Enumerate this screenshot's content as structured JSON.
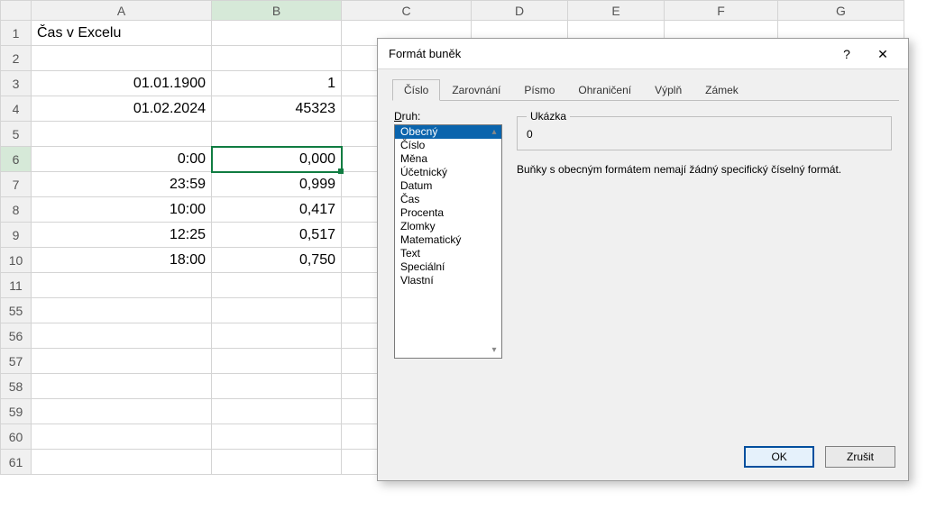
{
  "sheet": {
    "columns": [
      "A",
      "B",
      "C",
      "D",
      "E",
      "F",
      "G"
    ],
    "rows": [
      "1",
      "2",
      "3",
      "4",
      "5",
      "6",
      "7",
      "8",
      "9",
      "10",
      "11",
      "55",
      "56",
      "57",
      "58",
      "59",
      "60",
      "61"
    ],
    "active_col": "B",
    "active_row": "6",
    "title": "Čas v Excelu",
    "cells": {
      "A3": "01.01.1900",
      "B3": "1",
      "A4": "01.02.2024",
      "B4": "45323",
      "A6": "0:00",
      "B6": "0,000",
      "A7": "23:59",
      "B7": "0,999",
      "A8": "10:00",
      "B8": "0,417",
      "A9": "12:25",
      "B9": "0,517",
      "A10": "18:00",
      "B10": "0,750"
    }
  },
  "dialog": {
    "title": "Formát buněk",
    "help_icon": "?",
    "close_icon": "✕",
    "tabs": [
      "Číslo",
      "Zarovnání",
      "Písmo",
      "Ohraničení",
      "Výplň",
      "Zámek"
    ],
    "active_tab": 0,
    "druh_label_pre": "D",
    "druh_label_post": "ruh:",
    "categories": [
      "Obecný",
      "Číslo",
      "Měna",
      "Účetnický",
      "Datum",
      "Čas",
      "Procenta",
      "Zlomky",
      "Matematický",
      "Text",
      "Speciální",
      "Vlastní"
    ],
    "selected_category": 0,
    "preview_legend": "Ukázka",
    "preview_value": "0",
    "description": "Buňky s obecným formátem nemají žádný specifický číselný formát.",
    "ok_label": "OK",
    "cancel_label": "Zrušit"
  }
}
